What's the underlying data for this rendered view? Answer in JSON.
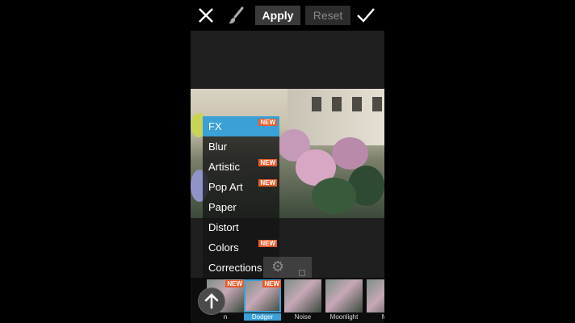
{
  "toolbar": {
    "close_icon": "close-icon",
    "brush_icon": "brush-icon",
    "apply_label": "Apply",
    "reset_label": "Reset",
    "check_icon": "checkmark-icon"
  },
  "menu": {
    "items": [
      {
        "label": "FX",
        "new": "NEW",
        "active": true
      },
      {
        "label": "Blur"
      },
      {
        "label": "Artistic",
        "new": "NEW"
      },
      {
        "label": "Pop Art",
        "new": "NEW"
      },
      {
        "label": "Paper"
      },
      {
        "label": "Distort"
      },
      {
        "label": "Colors",
        "new": "NEW"
      },
      {
        "label": "Corrections"
      }
    ]
  },
  "filters": {
    "thumbs": [
      {
        "label": "n",
        "new": "NEW"
      },
      {
        "label": "Dodger",
        "new": "NEW",
        "selected": true
      },
      {
        "label": "Noise"
      },
      {
        "label": "Moonlight"
      },
      {
        "label": "Mi"
      }
    ]
  },
  "colors": {
    "accent": "#3aa0d6",
    "new_badge": "#e85b2b"
  }
}
